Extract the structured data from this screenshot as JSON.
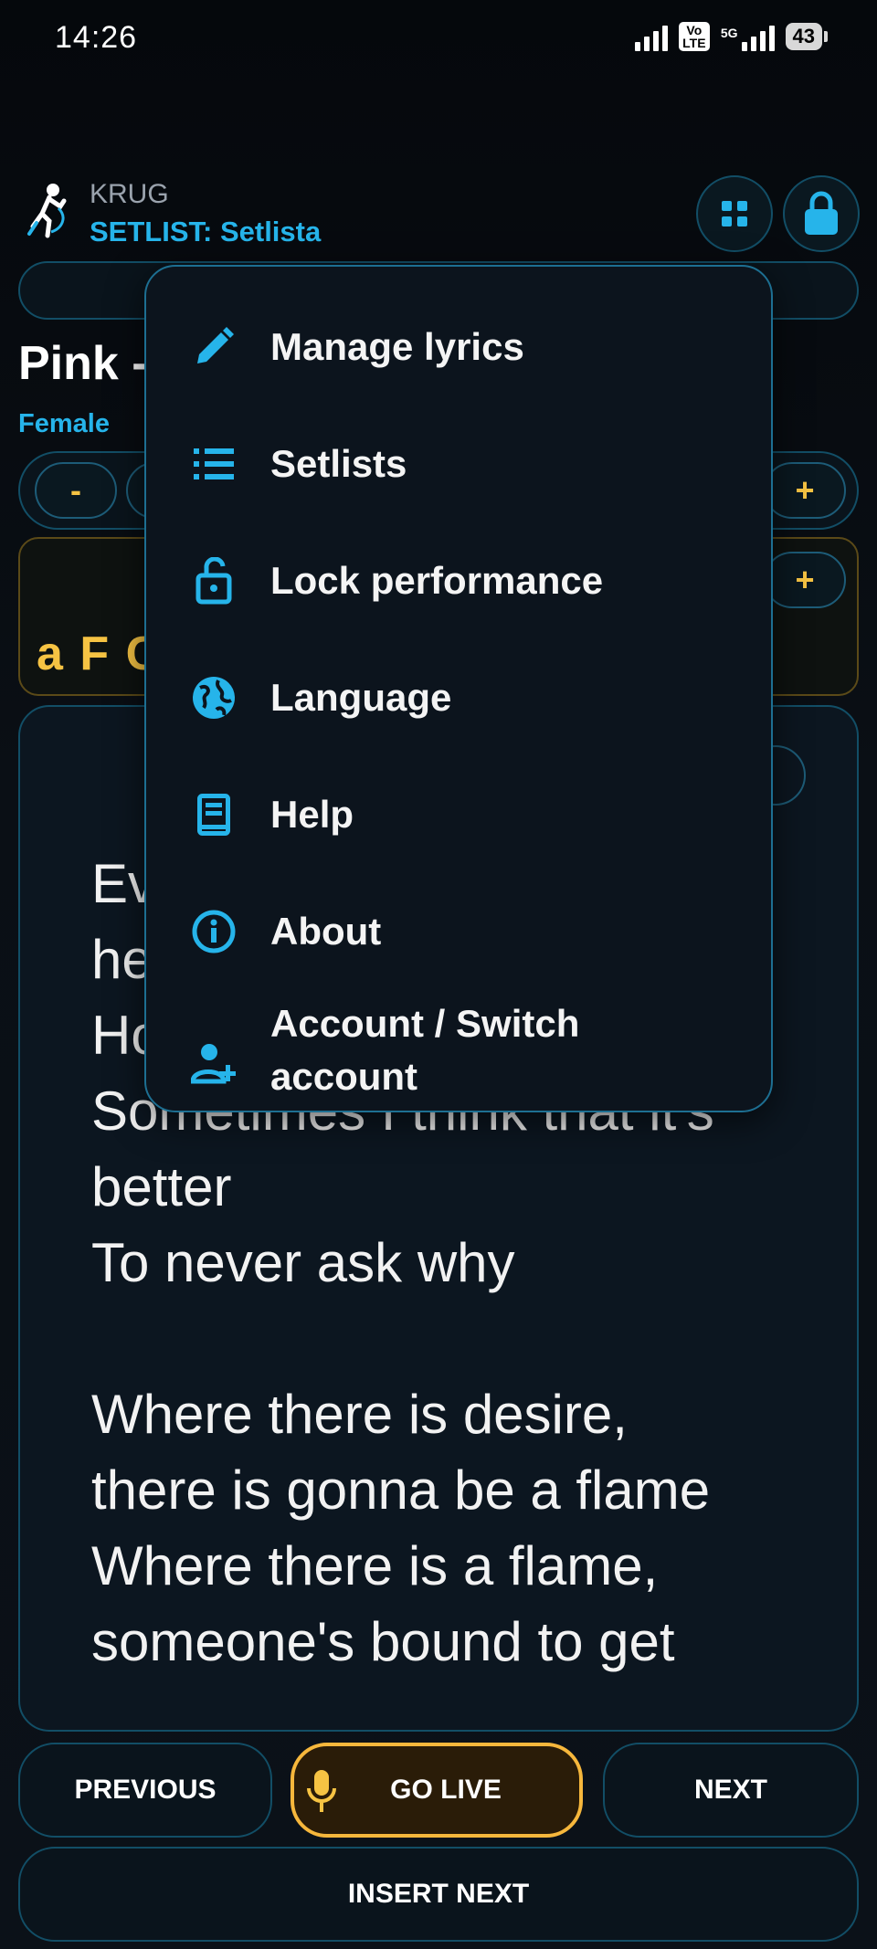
{
  "status_bar": {
    "time": "14:26",
    "volte": "Vo LTE",
    "network": "5G",
    "battery": "43"
  },
  "header": {
    "app_name": "KRUG",
    "setlist_label": "SETLIST: Setlista"
  },
  "song": {
    "title": "Pink -",
    "voice": "Female"
  },
  "controls": {
    "minus_label": "-",
    "plus_label": "+"
  },
  "chords": {
    "text": "a F C"
  },
  "lyrics": {
    "text": "Ev\nhe\nHo\nSometimes I think that it's\nbetter\nTo never ask why\n\nWhere there is desire,\nthere is gonna be a flame\nWhere there is a flame,\nsomeone's bound to get"
  },
  "menu": {
    "items": [
      {
        "label": "Manage lyrics",
        "icon": "pencil-icon"
      },
      {
        "label": "Setlists",
        "icon": "list-icon"
      },
      {
        "label": "Lock performance",
        "icon": "unlock-icon"
      },
      {
        "label": "Language",
        "icon": "globe-icon"
      },
      {
        "label": "Help",
        "icon": "book-icon"
      },
      {
        "label": "About",
        "icon": "info-icon"
      },
      {
        "label": "Account / Switch account",
        "icon": "add-user-icon"
      }
    ]
  },
  "bottom": {
    "previous": "PREVIOUS",
    "go_live": "GO LIVE",
    "next": "NEXT",
    "insert_next": "INSERT NEXT"
  },
  "colors": {
    "accent_blue": "#26b4ea",
    "accent_yellow": "#f6c343",
    "background": "#070b11"
  }
}
